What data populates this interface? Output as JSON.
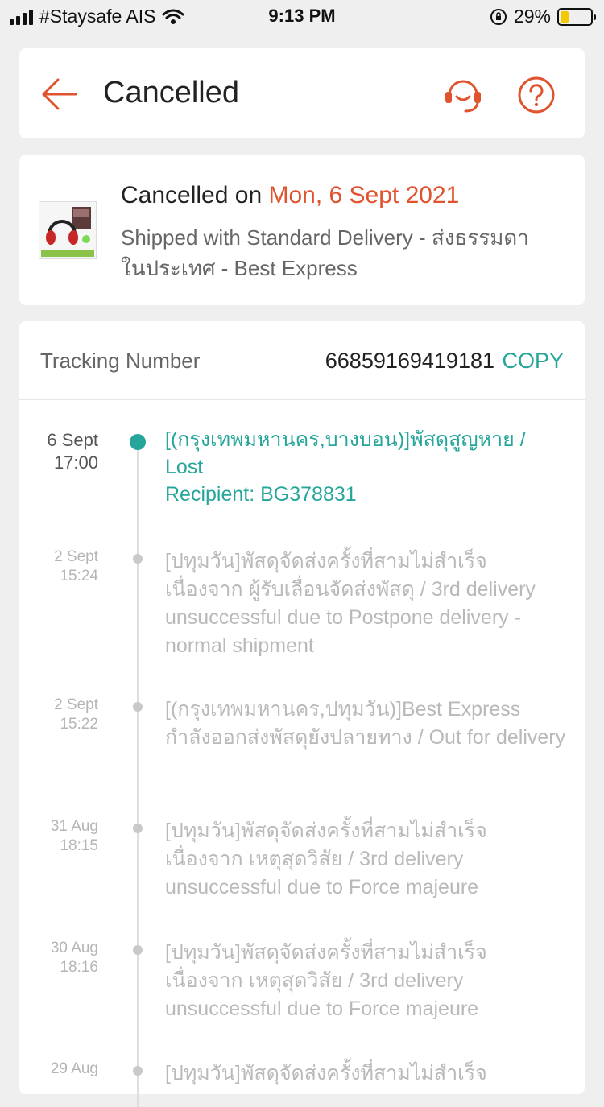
{
  "status_bar": {
    "carrier": "#Staysafe AIS",
    "time": "9:13 PM",
    "battery": "29%",
    "battery_level": 0.29
  },
  "header": {
    "title": "Cancelled",
    "back_icon": "back-arrow-icon",
    "support_icon": "headset-icon",
    "help_icon": "question-icon",
    "accent_color": "#e0532f"
  },
  "summary": {
    "cancelled_prefix": "Cancelled on",
    "cancelled_date": "Mon, 6 Sept 2021",
    "shipping_info": "Shipped with Standard Delivery - ส่งธรรมดาในประเทศ - Best Express"
  },
  "tracking": {
    "label": "Tracking Number",
    "number": "66859169419181",
    "copy_label": "COPY",
    "accent_color": "#26a69a",
    "events": [
      {
        "date": "6 Sept",
        "time": "17:00",
        "text": "[(กรุงเทพมหานคร,บางบอน)]พัสดุสูญหาย / Lost",
        "sub": "Recipient: BG378831"
      },
      {
        "date": "2 Sept",
        "time": "15:24",
        "text": "[ปทุมวัน]พัสดุจัดส่งครั้งที่สามไม่สำเร็จ เนื่องจาก ผู้รับเลื่อนจัดส่งพัสดุ / 3rd delivery unsuccessful due to Postpone delivery - normal shipment"
      },
      {
        "date": "2 Sept",
        "time": "15:22",
        "text": "[(กรุงเทพมหานคร,ปทุมวัน)]Best Express กำลังออกส่งพัสดุยังปลายทาง / Out for delivery"
      },
      {
        "date": "31 Aug",
        "time": "18:15",
        "text": "[ปทุมวัน]พัสดุจัดส่งครั้งที่สามไม่สำเร็จ เนื่องจาก เหตุสุดวิสัย / 3rd delivery unsuccessful due to Force majeure"
      },
      {
        "date": "30 Aug",
        "time": "18:16",
        "text": "[ปทุมวัน]พัสดุจัดส่งครั้งที่สามไม่สำเร็จ เนื่องจาก เหตุสุดวิสัย / 3rd delivery unsuccessful due to Force majeure"
      },
      {
        "date": "29 Aug",
        "time": "",
        "text": "[ปทุมวัน]พัสดุจัดส่งครั้งที่สามไม่สำเร็จ"
      }
    ]
  }
}
